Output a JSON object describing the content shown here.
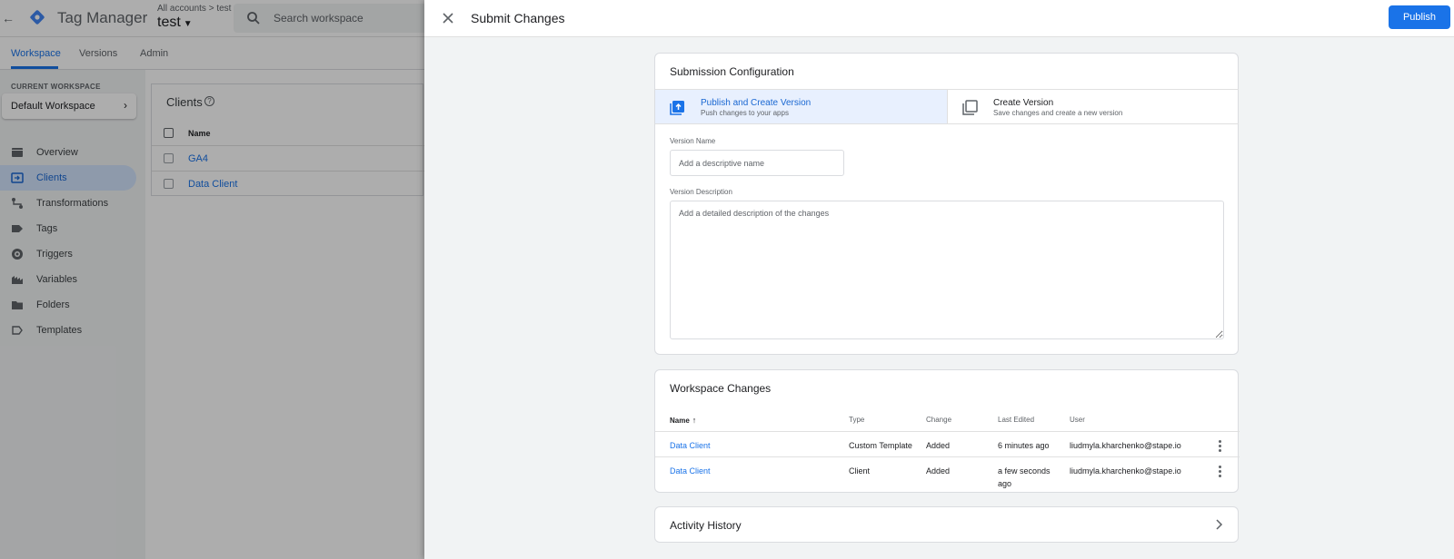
{
  "app": {
    "brand": "Tag Manager",
    "account_breadcrumb": "All accounts > test",
    "container_name": "test",
    "search_placeholder": "Search workspace"
  },
  "tabs": [
    {
      "label": "Workspace",
      "active": true
    },
    {
      "label": "Versions",
      "active": false
    },
    {
      "label": "Admin",
      "active": false
    }
  ],
  "sidebar": {
    "current_workspace_label": "CURRENT WORKSPACE",
    "workspace_name": "Default Workspace",
    "items": [
      {
        "label": "Overview",
        "icon": "overview-icon",
        "active": false
      },
      {
        "label": "Clients",
        "icon": "clients-icon",
        "active": true
      },
      {
        "label": "Transformations",
        "icon": "transformations-icon",
        "active": false
      },
      {
        "label": "Tags",
        "icon": "tag-icon",
        "active": false
      },
      {
        "label": "Triggers",
        "icon": "trigger-icon",
        "active": false
      },
      {
        "label": "Variables",
        "icon": "variables-icon",
        "active": false
      },
      {
        "label": "Folders",
        "icon": "folder-icon",
        "active": false
      },
      {
        "label": "Templates",
        "icon": "template-icon",
        "active": false
      }
    ]
  },
  "clients": {
    "title": "Clients",
    "column_name": "Name",
    "rows": [
      "GA4",
      "Data Client"
    ]
  },
  "panel": {
    "title": "Submit Changes",
    "publish_label": "Publish",
    "submission": {
      "title": "Submission Configuration",
      "options": [
        {
          "title": "Publish and Create Version",
          "subtitle": "Push changes to your apps",
          "selected": true
        },
        {
          "title": "Create Version",
          "subtitle": "Save changes and create a new version",
          "selected": false
        }
      ],
      "version_name_label": "Version Name",
      "version_name_placeholder": "Add a descriptive name",
      "version_description_label": "Version Description",
      "version_description_placeholder": "Add a detailed description of the changes"
    },
    "workspace_changes": {
      "title": "Workspace Changes",
      "columns": {
        "name": "Name",
        "type": "Type",
        "change": "Change",
        "last_edited": "Last Edited",
        "user": "User"
      },
      "rows": [
        {
          "name": "Data Client",
          "type": "Custom Template",
          "change": "Added",
          "last_edited": "6 minutes ago",
          "user": "liudmyla.kharchenko@stape.io"
        },
        {
          "name": "Data Client",
          "type": "Client",
          "change": "Added",
          "last_edited": "a few seconds ago",
          "user": "liudmyla.kharchenko@stape.io"
        }
      ]
    },
    "activity_history": {
      "title": "Activity History"
    }
  },
  "colors": {
    "accent": "#1a73e8",
    "selected_bg": "#e8f0fe",
    "nav_active_bg": "#d2e3fc"
  }
}
